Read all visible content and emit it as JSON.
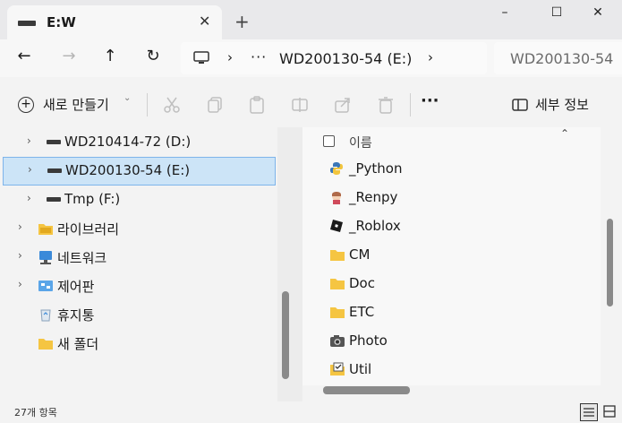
{
  "window": {
    "tab_title": "E:W",
    "new_tab_label": "+",
    "minimize_label": "–",
    "maximize_label": "☐",
    "close_label": "✕"
  },
  "nav": {
    "back_icon": "←",
    "forward_icon": "→",
    "up_icon": "↑",
    "refresh_icon": "↻",
    "address_chevron": "›",
    "address_ellipsis": "···",
    "address_drive": "WD200130-54 (E:)",
    "search_placeholder": "WD200130-54"
  },
  "toolbar": {
    "new_label": "새로 만들기",
    "new_caret": "⌄",
    "more_label": "···",
    "details_label": "세부 정보",
    "icons": [
      "cut-icon",
      "copy-icon",
      "paste-icon",
      "rename-icon",
      "share-icon",
      "delete-icon"
    ]
  },
  "tree": [
    {
      "label": "WD210414-72 (D:)",
      "icon": "drive-icon",
      "chevron": "›"
    },
    {
      "label": "WD200130-54 (E:)",
      "icon": "drive-icon",
      "chevron": "›",
      "selected": true
    },
    {
      "label": "Tmp (F:)",
      "icon": "drive-icon",
      "chevron": "›"
    },
    {
      "label": "라이브러리",
      "icon": "library-icon",
      "chevron": "›"
    },
    {
      "label": "네트워크",
      "icon": "network-icon",
      "chevron": "›"
    },
    {
      "label": "제어판",
      "icon": "control-panel-icon",
      "chevron": "›"
    },
    {
      "label": "휴지통",
      "icon": "recycle-bin-icon",
      "chevron": ""
    },
    {
      "label": "새 폴더",
      "icon": "folder-icon",
      "chevron": ""
    }
  ],
  "content": {
    "column_name": "이름",
    "sort_indicator": "⌃",
    "files": [
      {
        "name": "_Python",
        "icon": "python-icon"
      },
      {
        "name": "_Renpy",
        "icon": "renpy-icon"
      },
      {
        "name": "_Roblox",
        "icon": "roblox-icon"
      },
      {
        "name": "CM",
        "icon": "folder-icon"
      },
      {
        "name": "Doc",
        "icon": "folder-icon"
      },
      {
        "name": "ETC",
        "icon": "folder-icon"
      },
      {
        "name": "Photo",
        "icon": "camera-folder-icon"
      },
      {
        "name": "Util",
        "icon": "folder-check-icon"
      }
    ]
  },
  "status": {
    "item_count": "27개 항목"
  },
  "colors": {
    "selection_bg": "#cce4f7",
    "selection_border": "#7eb4ea",
    "folder_yellow": "#f5c542"
  }
}
